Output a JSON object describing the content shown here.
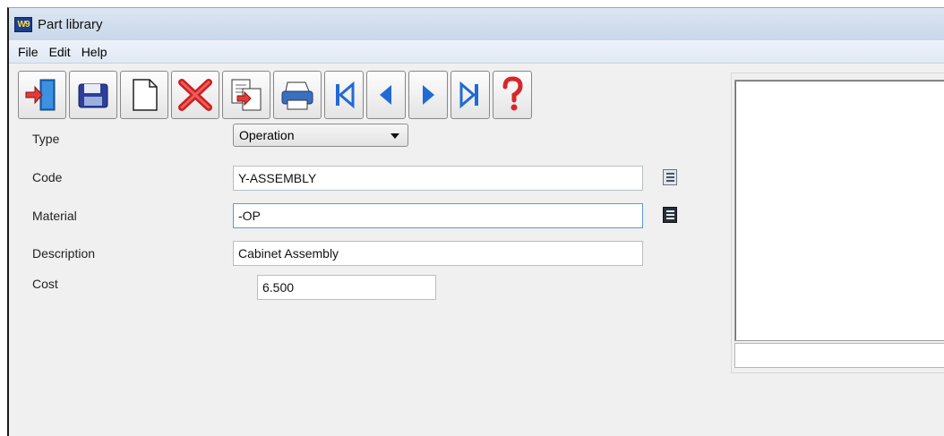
{
  "window": {
    "title": "Part library",
    "app_icon_text": "W9"
  },
  "menu": {
    "items": [
      "File",
      "Edit",
      "Help"
    ]
  },
  "toolbar": {
    "buttons": [
      "exit-icon",
      "save-icon",
      "new-icon",
      "delete-icon",
      "copy-icon",
      "print-icon",
      "first-record-icon",
      "previous-record-icon",
      "next-record-icon",
      "last-record-icon",
      "help-icon"
    ]
  },
  "form": {
    "type_label": "Type",
    "type_value": "Operation",
    "code_label": "Code",
    "code_value": "Y-ASSEMBLY",
    "material_label": "Material",
    "material_value": "-OP",
    "description_label": "Description",
    "description_value": "Cabinet Assembly",
    "cost_label": "Cost",
    "cost_value": "6.500"
  },
  "colors": {
    "accent": "#1f5fbf",
    "delete": "#cc1f1f",
    "help": "#d8262a",
    "nav": "#1f6ad6"
  }
}
